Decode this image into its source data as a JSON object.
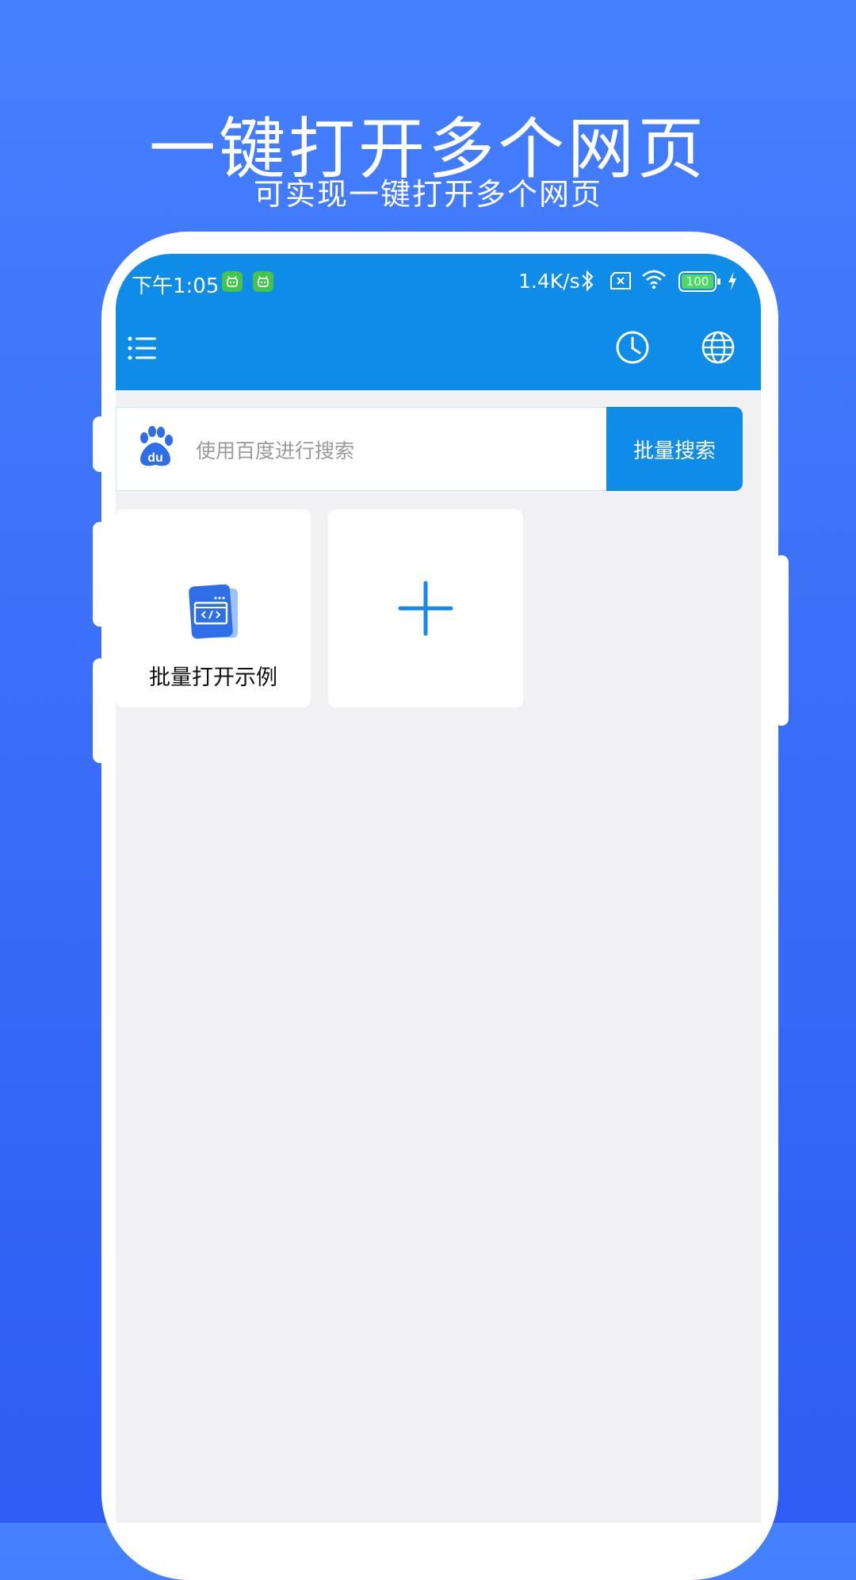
{
  "promo": {
    "headline": "一键打开多个网页",
    "subline": "可实现一键打开多个网页"
  },
  "status_bar": {
    "time": "下午1:05",
    "net_speed": "1.4K/s",
    "battery": "100"
  },
  "toolbar": {
    "icons": [
      "menu-icon",
      "history-clock-icon",
      "globe-icon"
    ]
  },
  "search": {
    "engine_icon": "baidu-paw-icon",
    "placeholder": "使用百度进行搜索",
    "value": "",
    "button_label": "批量搜索"
  },
  "cards": [
    {
      "label": "批量打开示例",
      "icon": "web-page-code-icon"
    },
    {
      "label": "",
      "icon": "add-plus-icon"
    }
  ],
  "colors": {
    "background_top": "#4580ff",
    "background_bottom": "#2f5cf4",
    "app_primary": "#0f8be8",
    "screen_bg": "#f1f1f3"
  }
}
